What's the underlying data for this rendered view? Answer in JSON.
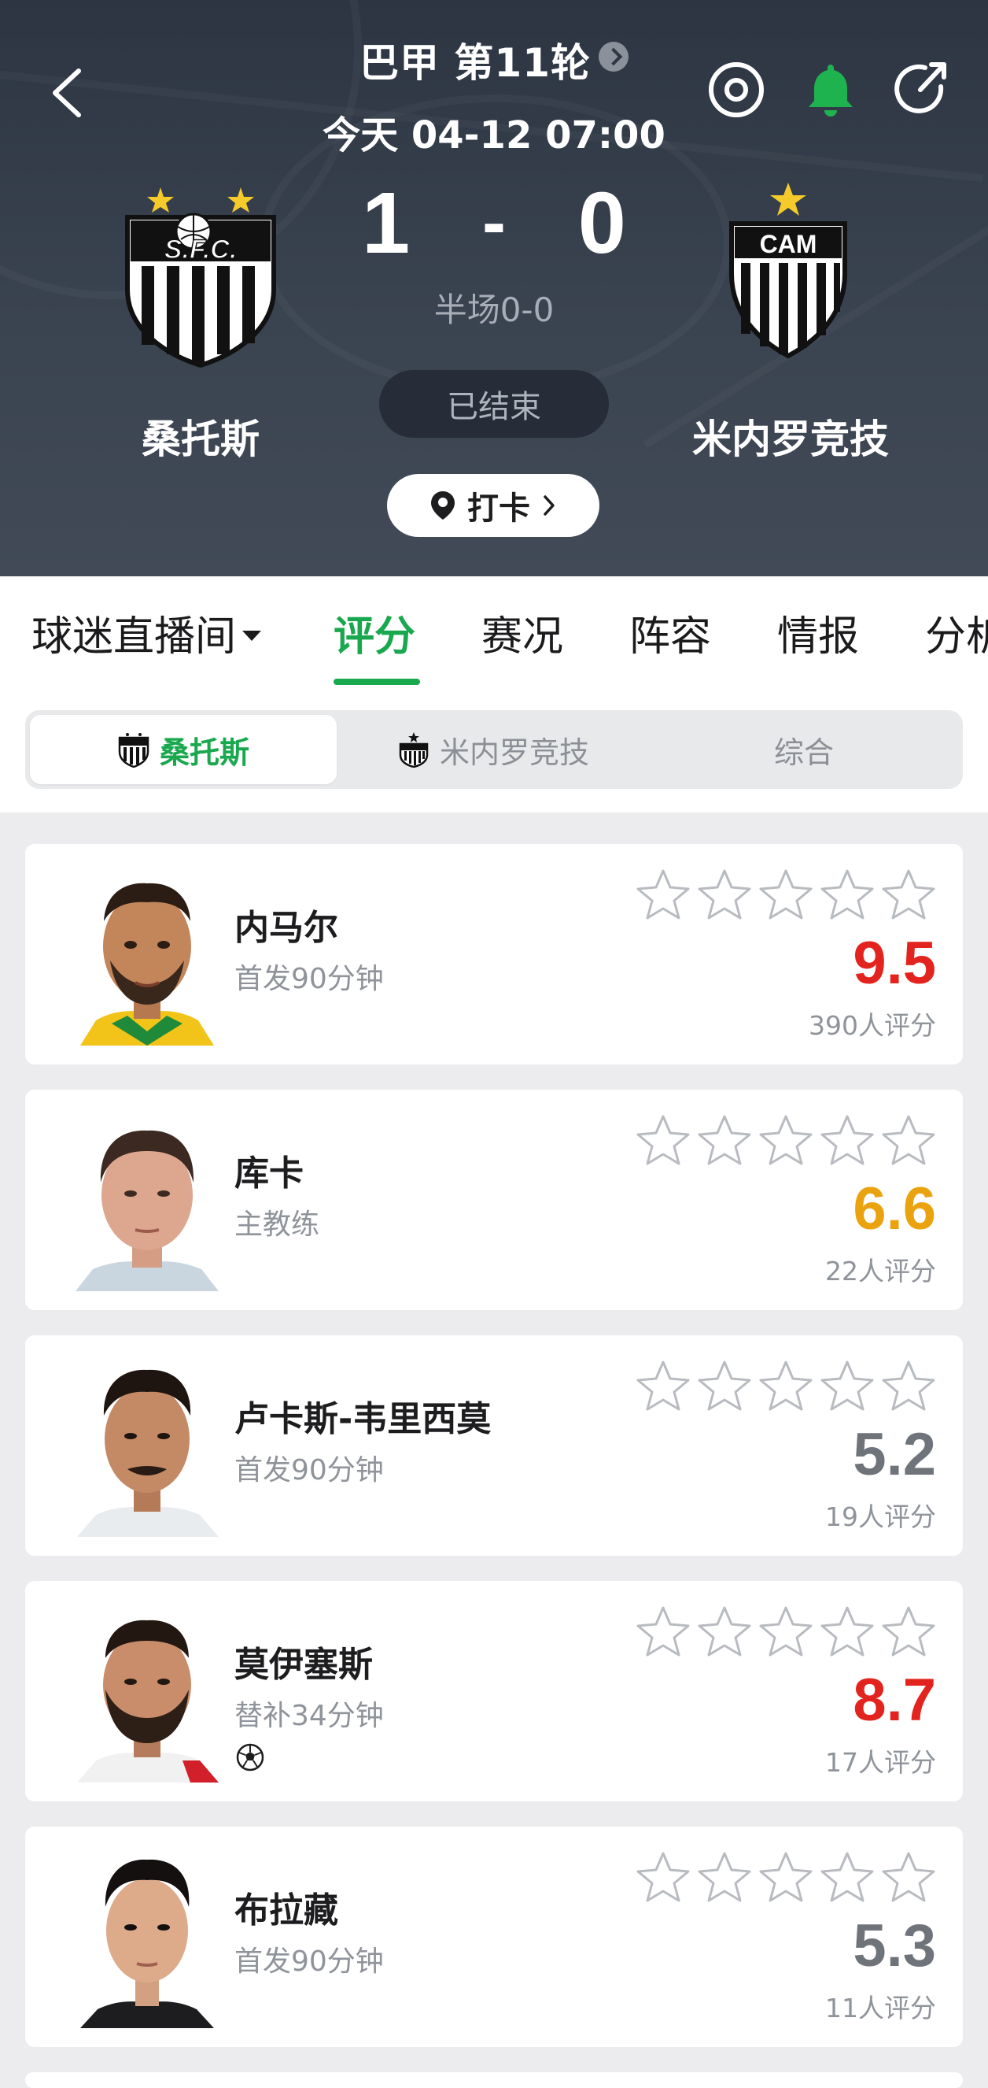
{
  "header": {
    "league": "巴甲 第11轮",
    "datetime": "今天 04-12 07:00",
    "home_team": "桑托斯",
    "away_team": "米内罗竞技",
    "home_score": "1",
    "score_sep": "-",
    "away_score": "0",
    "halftime": "半场0-0",
    "status": "已结束",
    "checkin_label": "打卡",
    "home_crest_text": "S.F.C.",
    "away_crest_text": "CAM",
    "icons": [
      "back-arrow-icon",
      "target-icon",
      "bell-icon",
      "share-icon",
      "location-pin-icon"
    ],
    "bell_color": "#1fb34f"
  },
  "tabs": [
    {
      "label": "球迷直播间",
      "active": false
    },
    {
      "label": "评分",
      "active": true
    },
    {
      "label": "赛况",
      "active": false
    },
    {
      "label": "阵容",
      "active": false
    },
    {
      "label": "情报",
      "active": false
    },
    {
      "label": "分析",
      "active": false
    }
  ],
  "segments": [
    {
      "label": "桑托斯",
      "active": true
    },
    {
      "label": "米内罗竞技",
      "active": false
    },
    {
      "label": "综合",
      "active": false
    }
  ],
  "players": [
    {
      "name": "内马尔",
      "role": "首发90分钟",
      "rating": "9.5",
      "rating_color": "red",
      "count": "390人评分",
      "stars": 0
    },
    {
      "name": "库卡",
      "role": "主教练",
      "rating": "6.6",
      "rating_color": "gold",
      "count": "22人评分",
      "stars": 0
    },
    {
      "name": "卢卡斯-韦里西莫",
      "role": "首发90分钟",
      "rating": "5.2",
      "rating_color": "gray",
      "count": "19人评分",
      "stars": 0
    },
    {
      "name": "莫伊塞斯",
      "role": "替补34分钟",
      "rating": "8.7",
      "rating_color": "red",
      "count": "17人评分",
      "stars": 0,
      "goal_icon": "soccer-ball-icon"
    },
    {
      "name": "布拉藏",
      "role": "首发90分钟",
      "rating": "5.3",
      "rating_color": "gray",
      "count": "11人评分",
      "stars": 0
    }
  ],
  "colors": {
    "accent": "#19a84e",
    "rating_red": "#e3231d",
    "rating_gold": "#eaa30f",
    "rating_gray": "#6f747b"
  }
}
